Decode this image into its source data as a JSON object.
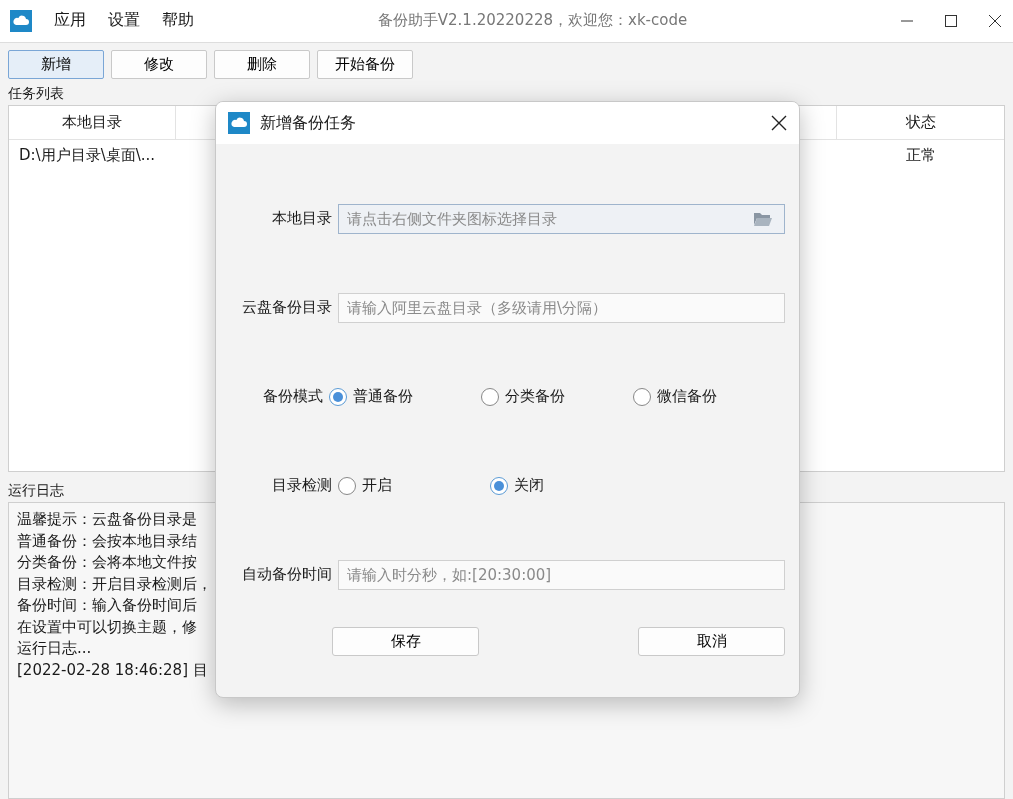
{
  "window": {
    "title": "备份助手V2.1.20220228，欢迎您：xk-code"
  },
  "menu": [
    "应用",
    "设置",
    "帮助"
  ],
  "toolbar": [
    {
      "label": "新增",
      "selected": true
    },
    {
      "label": "修改",
      "selected": false
    },
    {
      "label": "删除",
      "selected": false
    },
    {
      "label": "开始备份",
      "selected": false
    }
  ],
  "task_list": {
    "label": "任务列表",
    "columns": [
      "本地目录",
      "状态"
    ],
    "rows": [
      {
        "local_dir": "D:\\用户目录\\桌面\\...",
        "status": "正常"
      }
    ]
  },
  "log": {
    "label": "运行日志",
    "lines": [
      "温馨提示：云盘备份目录是",
      "普通备份：会按本地目录结",
      "分类备份：会将本地文件按",
      "目录检测：开启目录检测后，",
      "备份时间：输入备份时间后",
      "在设置中可以切换主题，修",
      "运行日志...",
      "[2022-02-28 18:46:28] 目"
    ]
  },
  "dialog": {
    "title": "新增备份任务",
    "fields": [
      {
        "kind": "folder",
        "label": "本地目录",
        "placeholder": "请点击右侧文件夹图标选择目录"
      },
      {
        "kind": "text",
        "label": "云盘备份目录",
        "placeholder": "请输入阿里云盘目录（多级请用\\分隔）"
      },
      {
        "kind": "radio",
        "label": "备份模式",
        "options": [
          {
            "label": "普通备份",
            "selected": true
          },
          {
            "label": "分类备份",
            "selected": false
          },
          {
            "label": "微信备份",
            "selected": false
          }
        ]
      },
      {
        "kind": "radio",
        "label": "目录检测",
        "options": [
          {
            "label": "开启",
            "selected": false
          },
          {
            "label": "关闭",
            "selected": true
          }
        ]
      },
      {
        "kind": "text",
        "label": "自动备份时间",
        "placeholder": "请输入时分秒，如:[20:30:00]"
      }
    ],
    "buttons": [
      "保存",
      "取消"
    ]
  }
}
